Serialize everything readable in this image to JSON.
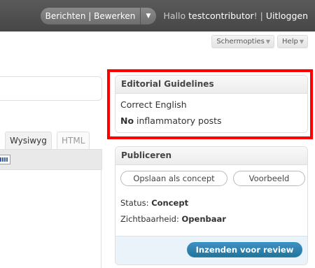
{
  "header": {
    "favorites_label": "Berichten | Bewerken",
    "favorites_arrow": "▼",
    "greeting": "Hallo",
    "username": "testcontributor",
    "separator": "! |",
    "logout": "Uitloggen"
  },
  "meta": {
    "screen_options": "Schermopties",
    "help": "Help",
    "arrow": "▼"
  },
  "editor": {
    "tab_visual": "Wysiwyg",
    "tab_html": "HTML"
  },
  "editorial": {
    "title": "Editorial Guidelines",
    "line1": "Correct English",
    "line2_bold": "No",
    "line2_rest": " inflammatory posts"
  },
  "publish": {
    "title": "Publiceren",
    "save_draft": "Opslaan als concept",
    "preview": "Voorbeeld",
    "status_label": "Status: ",
    "status_value": "Concept",
    "visibility_label": "Zichtbaarheid: ",
    "visibility_value": "Openbaar",
    "submit": "Inzenden voor review"
  },
  "colors": {
    "highlight": "#ff0000",
    "submit": "#21759b",
    "header": "#464646"
  }
}
